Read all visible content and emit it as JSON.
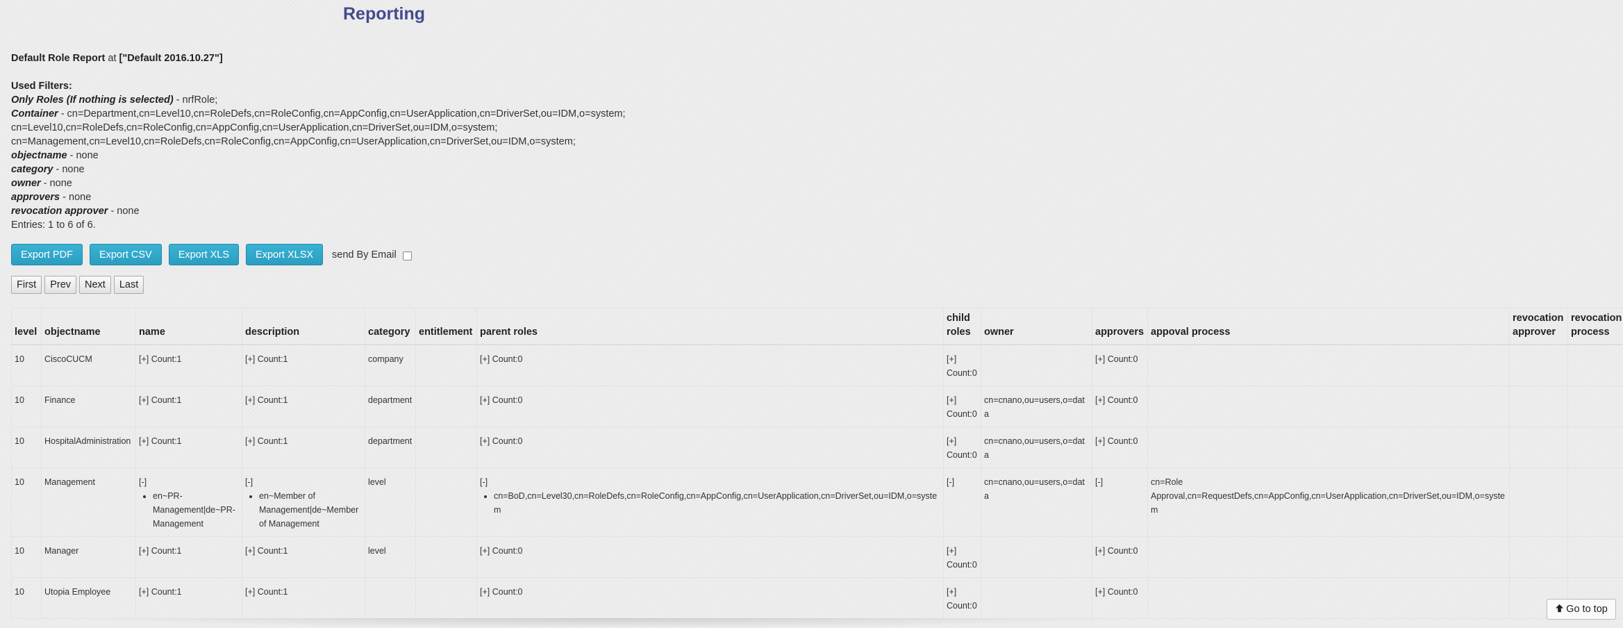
{
  "page": {
    "title": "Reporting"
  },
  "report": {
    "heading_bold": "Default Role Report",
    "heading_at": "at",
    "heading_version": "[\"Default 2016.10.27\"]",
    "used_filters_label": "Used Filters:",
    "filters": [
      {
        "name": "Only Roles (If nothing is selected)",
        "value": " - nrfRole;"
      },
      {
        "name": "Container",
        "value": " - cn=Department,cn=Level10,cn=RoleDefs,cn=RoleConfig,cn=AppConfig,cn=UserApplication,cn=DriverSet,ou=IDM,o=system;"
      },
      {
        "name": "",
        "value": "cn=Level10,cn=RoleDefs,cn=RoleConfig,cn=AppConfig,cn=UserApplication,cn=DriverSet,ou=IDM,o=system;"
      },
      {
        "name": "",
        "value": "cn=Management,cn=Level10,cn=RoleDefs,cn=RoleConfig,cn=AppConfig,cn=UserApplication,cn=DriverSet,ou=IDM,o=system;"
      },
      {
        "name": "objectname",
        "value": " - none"
      },
      {
        "name": "category",
        "value": " - none"
      },
      {
        "name": "owner",
        "value": " - none"
      },
      {
        "name": "approvers",
        "value": " - none"
      },
      {
        "name": "revocation approver",
        "value": " - none"
      }
    ],
    "entries": "Entries: 1 to 6 of 6."
  },
  "actions": {
    "export_pdf": "Export PDF",
    "export_csv": "Export CSV",
    "export_xls": "Export XLS",
    "export_xlsx": "Export XLSX",
    "send_by_email": "send By Email"
  },
  "pager": {
    "first": "First",
    "prev": "Prev",
    "next": "Next",
    "last": "Last"
  },
  "table": {
    "columns": [
      "level",
      "objectname",
      "name",
      "description",
      "category",
      "entitlement",
      "parent roles",
      "child roles",
      "owner",
      "approvers",
      "appoval process",
      "revocation approver",
      "revocation process"
    ],
    "rows": [
      {
        "level": "10",
        "objectname": "CiscoCUCM",
        "name": "[+] Count:1",
        "description": "[+] Count:1",
        "category": "company",
        "entitlement": "",
        "parent_roles": "[+] Count:0",
        "child_roles": "[+] Count:0",
        "owner": "",
        "approvers": "[+] Count:0",
        "approval_process": "",
        "revocation_approver": "",
        "revocation_process": ""
      },
      {
        "level": "10",
        "objectname": "Finance",
        "name": "[+] Count:1",
        "description": "[+] Count:1",
        "category": "department",
        "entitlement": "",
        "parent_roles": "[+] Count:0",
        "child_roles": "[+] Count:0",
        "owner": "cn=cnano,ou=users,o=data",
        "approvers": "[+] Count:0",
        "approval_process": "",
        "revocation_approver": "",
        "revocation_process": ""
      },
      {
        "level": "10",
        "objectname": "HospitalAdministration",
        "name": "[+] Count:1",
        "description": "[+] Count:1",
        "category": "department",
        "entitlement": "",
        "parent_roles": "[+] Count:0",
        "child_roles": "[+] Count:0",
        "owner": "cn=cnano,ou=users,o=data",
        "approvers": "[+] Count:0",
        "approval_process": "",
        "revocation_approver": "",
        "revocation_process": ""
      },
      {
        "level": "10",
        "objectname": "Management",
        "name_toggle": "[-]",
        "name_item": "en~PR-Management|de~PR-Management",
        "description_toggle": "[-]",
        "description_item": "en~Member of Management|de~Member of Management",
        "category": "level",
        "entitlement": "",
        "parent_roles_toggle": "[-]",
        "parent_roles_item": "cn=BoD,cn=Level30,cn=RoleDefs,cn=RoleConfig,cn=AppConfig,cn=UserApplication,cn=DriverSet,ou=IDM,o=system",
        "child_roles": "[-]",
        "owner": "cn=cnano,ou=users,o=data",
        "approvers": "[-]",
        "approval_process": "cn=Role Approval,cn=RequestDefs,cn=AppConfig,cn=UserApplication,cn=DriverSet,ou=IDM,o=system",
        "revocation_approver": "",
        "revocation_process": ""
      },
      {
        "level": "10",
        "objectname": "Manager",
        "name": "[+] Count:1",
        "description": "[+] Count:1",
        "category": "level",
        "entitlement": "",
        "parent_roles": "[+] Count:0",
        "child_roles": "[+] Count:0",
        "owner": "",
        "approvers": "[+] Count:0",
        "approval_process": "",
        "revocation_approver": "",
        "revocation_process": ""
      },
      {
        "level": "10",
        "objectname": "Utopia Employee",
        "name": "[+] Count:1",
        "description": "[+] Count:1",
        "category": "",
        "entitlement": "",
        "parent_roles": "[+] Count:0",
        "child_roles": "[+] Count:0",
        "owner": "",
        "approvers": "[+] Count:0",
        "approval_process": "",
        "revocation_approver": "",
        "revocation_process": ""
      }
    ]
  },
  "footer": {
    "go_to_top": "Go to top",
    "go_to_top_icon": "arrow-up-icon"
  }
}
